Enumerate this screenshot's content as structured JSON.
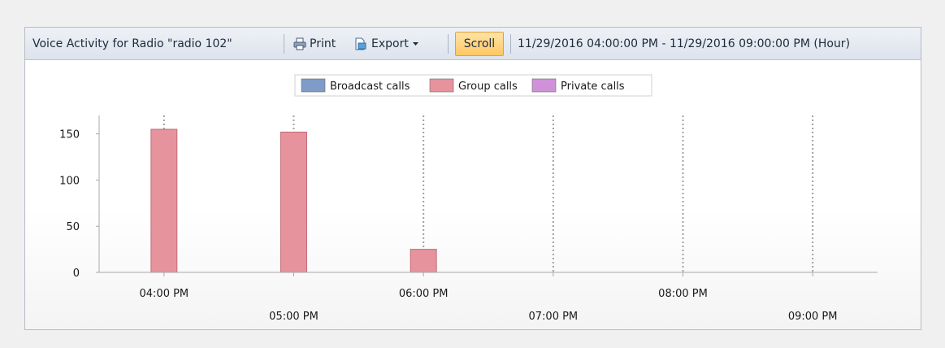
{
  "toolbar": {
    "title": "Voice Activity for Radio \"radio 102\"",
    "print_label": "Print",
    "export_label": "Export",
    "scroll_label": "Scroll",
    "range_label": "11/29/2016 04:00:00 PM - 11/29/2016 09:00:00 PM (Hour)"
  },
  "icons": {
    "print": "printer-icon",
    "export": "export-icon",
    "export_menu": "dropdown-arrow-icon"
  },
  "colors": {
    "broadcast": "#7f9bc8",
    "group": "#e6939e",
    "private": "#cf92d9",
    "scroll_button": "#ffc860"
  },
  "chart_data": {
    "type": "bar",
    "categories": [
      "04:00 PM",
      "05:00 PM",
      "06:00 PM",
      "07:00 PM",
      "08:00 PM",
      "09:00 PM"
    ],
    "series": [
      {
        "name": "Broadcast calls",
        "values": [
          0,
          0,
          0,
          0,
          0,
          0
        ]
      },
      {
        "name": "Group calls",
        "values": [
          155,
          152,
          25,
          0,
          0,
          0
        ]
      },
      {
        "name": "Private calls",
        "values": [
          0,
          0,
          0,
          0,
          0,
          0
        ]
      }
    ],
    "yticks": [
      0,
      50,
      100,
      150
    ],
    "ylim": [
      0,
      170
    ],
    "legend_position": "top-center",
    "grid": "vertical dotted"
  }
}
